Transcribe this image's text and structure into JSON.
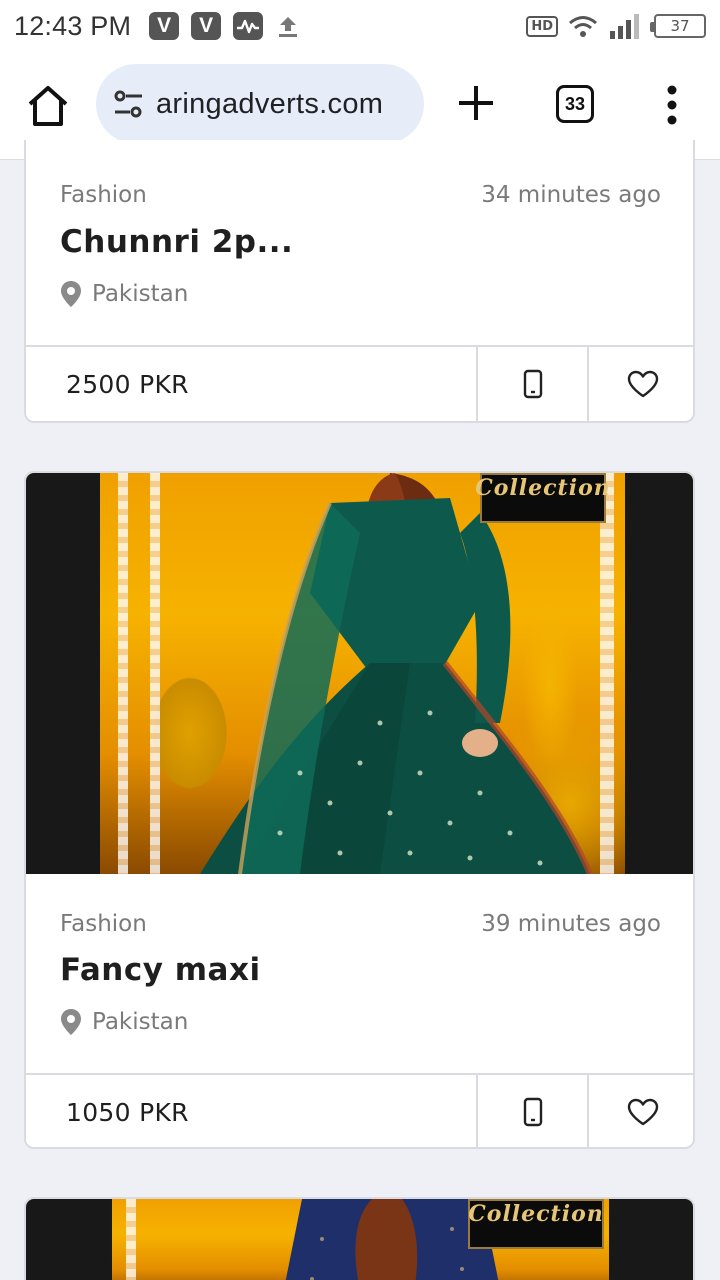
{
  "status_bar": {
    "time": "12:43 PM",
    "app_icons": [
      "V",
      "V"
    ],
    "hd_label": "HD",
    "battery": "37"
  },
  "browser": {
    "url": "aringadverts.com",
    "tab_count": "33"
  },
  "listings": [
    {
      "category": "Fashion",
      "time_ago": "34 minutes ago",
      "title": "Chunnri 2p...",
      "location": "Pakistan",
      "price": "2500 PKR"
    },
    {
      "category": "Fashion",
      "time_ago": "39 minutes ago",
      "title": "Fancy maxi",
      "location": "Pakistan",
      "price": "1050 PKR",
      "image_watermark": "Collection"
    },
    {
      "image_watermark": "Collection"
    }
  ],
  "icons": {
    "home": "home-icon",
    "site_settings": "tune-icon",
    "new_tab": "plus-icon",
    "menu": "more-vert-icon",
    "phone": "phone-icon",
    "favorite": "heart-icon",
    "location": "pin-icon"
  },
  "colors": {
    "page_bg": "#eef0f5",
    "url_bar_bg": "#e7edf8",
    "dress_green": "#0d5a4c",
    "dress_navy": "#1f2f6a"
  }
}
